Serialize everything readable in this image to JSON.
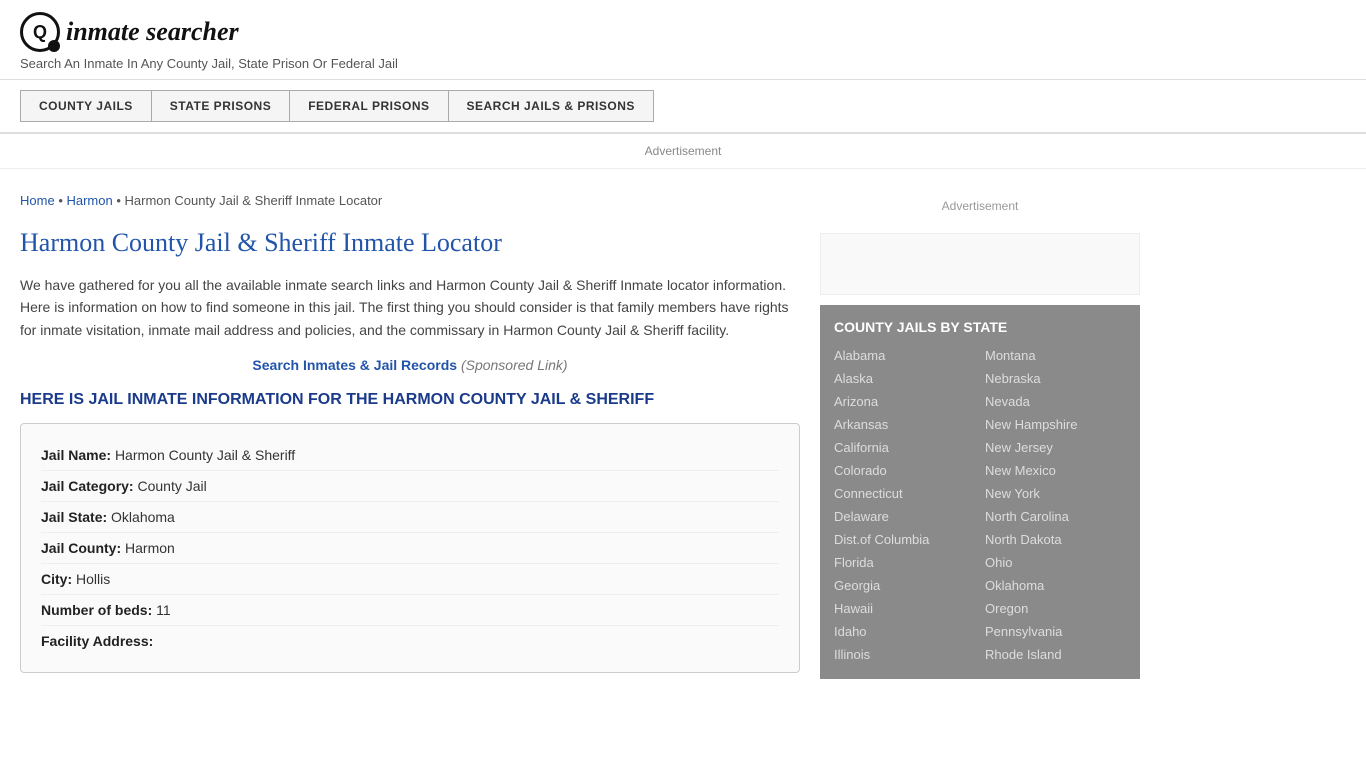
{
  "header": {
    "logo_icon": "🔍",
    "logo_text": "inmate searcher",
    "tagline": "Search An Inmate In Any County Jail, State Prison Or Federal Jail"
  },
  "nav": {
    "items": [
      {
        "id": "county-jails",
        "label": "COUNTY JAILS"
      },
      {
        "id": "state-prisons",
        "label": "STATE PRISONS"
      },
      {
        "id": "federal-prisons",
        "label": "FEDERAL PRISONS"
      },
      {
        "id": "search-jails",
        "label": "SEARCH JAILS & PRISONS"
      }
    ]
  },
  "ad": {
    "label": "Advertisement"
  },
  "breadcrumb": {
    "home": "Home",
    "parent": "Harmon",
    "current": "Harmon County Jail & Sheriff Inmate Locator"
  },
  "page": {
    "title": "Harmon County Jail & Sheriff Inmate Locator",
    "description": "We have gathered for you all the available inmate search links and Harmon County Jail & Sheriff Inmate locator information. Here is information on how to find someone in this jail. The first thing you should consider is that family members have rights for inmate visitation, inmate mail address and policies, and the commissary in Harmon County Jail & Sheriff facility.",
    "search_link_text": "Search Inmates & Jail Records",
    "search_link_sponsored": "(Sponsored Link)",
    "info_heading": "HERE IS JAIL INMATE INFORMATION FOR THE HARMON COUNTY JAIL & SHERIFF"
  },
  "jail_info": {
    "rows": [
      {
        "label": "Jail Name:",
        "value": "Harmon County Jail & Sheriff"
      },
      {
        "label": "Jail Category:",
        "value": "County Jail"
      },
      {
        "label": "Jail State:",
        "value": "Oklahoma"
      },
      {
        "label": "Jail County:",
        "value": "Harmon"
      },
      {
        "label": "City:",
        "value": "Hollis"
      },
      {
        "label": "Number of beds:",
        "value": "11"
      },
      {
        "label": "Facility Address:",
        "value": ""
      }
    ]
  },
  "sidebar": {
    "ad_label": "Advertisement",
    "section_title": "COUNTY JAILS BY STATE",
    "states_left": [
      "Alabama",
      "Alaska",
      "Arizona",
      "Arkansas",
      "California",
      "Colorado",
      "Connecticut",
      "Delaware",
      "Dist.of Columbia",
      "Florida",
      "Georgia",
      "Hawaii",
      "Idaho",
      "Illinois"
    ],
    "states_right": [
      "Montana",
      "Nebraska",
      "Nevada",
      "New Hampshire",
      "New Jersey",
      "New Mexico",
      "New York",
      "North Carolina",
      "North Dakota",
      "Ohio",
      "Oklahoma",
      "Oregon",
      "Pennsylvania",
      "Rhode Island"
    ]
  }
}
